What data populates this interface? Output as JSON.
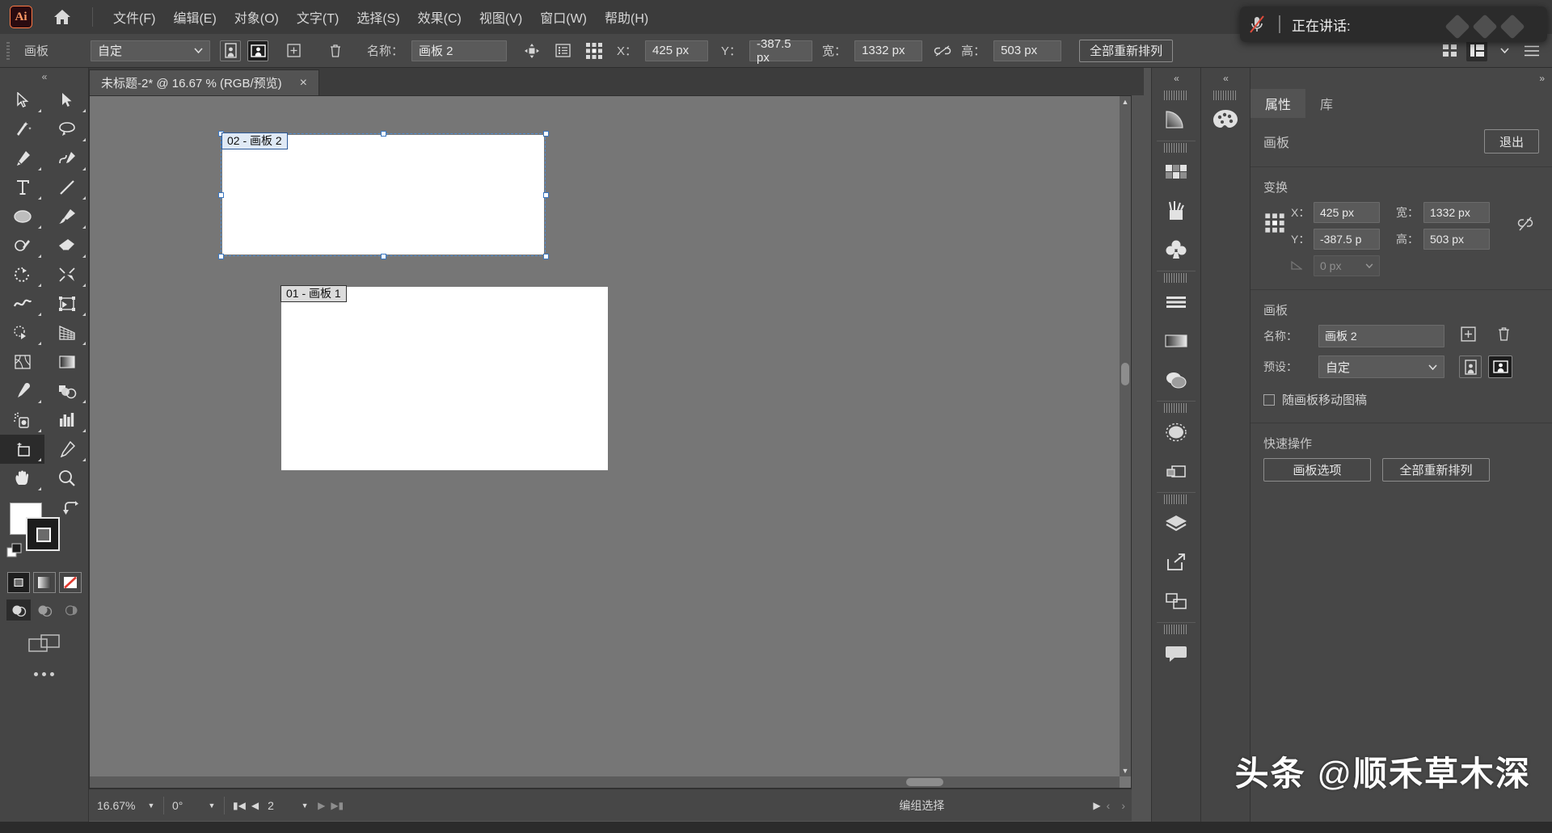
{
  "app": {
    "logo_text": "Ai",
    "home_icon": "home-icon"
  },
  "menubar": {
    "items": [
      {
        "label": "文件(F)"
      },
      {
        "label": "编辑(E)"
      },
      {
        "label": "对象(O)"
      },
      {
        "label": "文字(T)"
      },
      {
        "label": "选择(S)"
      },
      {
        "label": "效果(C)"
      },
      {
        "label": "视图(V)"
      },
      {
        "label": "窗口(W)"
      },
      {
        "label": "帮助(H)"
      }
    ]
  },
  "controlbar": {
    "tool_label": "画板",
    "preset_value": "自定",
    "orientation_portrait_icon": "portrait-icon",
    "orientation_landscape_icon": "landscape-icon",
    "new_artboard_icon": "new-artboard-icon",
    "delete_artboard_icon": "trash-icon",
    "name_label": "名称：",
    "name_value": "画板 2",
    "move_copy_icon": "move-artboard-icon",
    "options_icon": "artboard-options-icon",
    "reference_point_icon": "reference-point-icon",
    "x_label": "X：",
    "x_value": "425 px",
    "y_label": "Y：",
    "y_value": "-387.5 px",
    "w_label": "宽：",
    "w_value": "1332 px",
    "link_icon": "unlink-icon",
    "h_label": "高：",
    "h_value": "503 px",
    "rearrange_label": "全部重新排列",
    "right_icons": [
      "grid-view-icon",
      "workspace-icon",
      "chevron-down-icon",
      "menu-icon"
    ]
  },
  "toolbar": {
    "collapse_icon": "collapse-left-icon",
    "tools": [
      {
        "name": "selection-tool",
        "glyph": "select"
      },
      {
        "name": "direct-selection-tool",
        "glyph": "direct"
      },
      {
        "name": "magic-wand-tool",
        "glyph": "wand"
      },
      {
        "name": "lasso-tool",
        "glyph": "lasso"
      },
      {
        "name": "pen-tool",
        "glyph": "pen"
      },
      {
        "name": "curvature-tool",
        "glyph": "curvature"
      },
      {
        "name": "type-tool",
        "glyph": "type"
      },
      {
        "name": "line-segment-tool",
        "glyph": "line"
      },
      {
        "name": "ellipse-tool",
        "glyph": "ellipse"
      },
      {
        "name": "paintbrush-tool",
        "glyph": "brush"
      },
      {
        "name": "shaper-tool",
        "glyph": "shaper"
      },
      {
        "name": "eraser-tool",
        "glyph": "eraser"
      },
      {
        "name": "rotate-tool",
        "glyph": "rotate"
      },
      {
        "name": "scale-tool",
        "glyph": "scale"
      },
      {
        "name": "width-tool",
        "glyph": "width"
      },
      {
        "name": "free-transform-tool",
        "glyph": "freetransform"
      },
      {
        "name": "shape-builder-tool",
        "glyph": "shapebuilder"
      },
      {
        "name": "perspective-grid-tool",
        "glyph": "perspective"
      },
      {
        "name": "mesh-tool",
        "glyph": "mesh"
      },
      {
        "name": "gradient-tool",
        "glyph": "gradient"
      },
      {
        "name": "eyedropper-tool",
        "glyph": "eyedropper"
      },
      {
        "name": "blend-tool",
        "glyph": "blend"
      },
      {
        "name": "symbol-sprayer-tool",
        "glyph": "sprayer"
      },
      {
        "name": "column-graph-tool",
        "glyph": "graph"
      },
      {
        "name": "artboard-tool",
        "glyph": "artboard",
        "selected": true
      },
      {
        "name": "slice-tool",
        "glyph": "slice"
      },
      {
        "name": "hand-tool",
        "glyph": "hand"
      },
      {
        "name": "zoom-tool",
        "glyph": "zoom"
      }
    ],
    "fill_color": "#ffffff",
    "stroke_color": "#1c1c1c",
    "swap_icon": "swap-fill-stroke-icon",
    "default_icon": "default-fill-stroke-icon",
    "paint_modes": [
      "color-mode-icon",
      "gradient-mode-icon",
      "none-mode-icon"
    ],
    "draw_modes": [
      "draw-normal-icon",
      "draw-behind-icon",
      "draw-inside-icon"
    ],
    "screen_mode_icon": "screen-mode-icon",
    "more_icon": "more-tools-icon"
  },
  "document": {
    "tab_title": "未标题-2* @ 16.67 % (RGB/预览)",
    "close_icon": "close-icon"
  },
  "canvas": {
    "artboards": [
      {
        "id": "02",
        "label": "02 - 画板 2",
        "selected": true
      },
      {
        "id": "01",
        "label": "01 - 画板 1",
        "selected": false
      }
    ]
  },
  "statusbar": {
    "zoom_value": "16.67%",
    "rotation_value": "0°",
    "artboard_nav": {
      "first_icon": "first-artboard-icon",
      "prev_icon": "prev-artboard-icon",
      "value": "2",
      "next_icon": "next-artboard-icon",
      "last_icon": "last-artboard-icon"
    },
    "status_text": "编组选择",
    "play_icon": "play-icon",
    "prev_icon": "chevron-left-icon",
    "next_icon": "chevron-right-icon"
  },
  "dock": {
    "column1": [
      {
        "name": "gradient-panel-icon"
      },
      {
        "name": "swatches-panel-icon"
      },
      {
        "name": "brushes-panel-icon"
      },
      {
        "name": "symbols-panel-icon"
      },
      {
        "name": "align-panel-icon"
      },
      {
        "name": "stroke-panel-icon"
      },
      {
        "name": "transparency-panel-icon"
      },
      {
        "name": "appearance-panel-icon"
      },
      {
        "name": "pathfinder-panel-icon"
      },
      {
        "name": "layers-panel-icon"
      },
      {
        "name": "asset-export-panel-icon"
      },
      {
        "name": "artboards-panel-icon"
      },
      {
        "name": "comments-panel-icon"
      }
    ],
    "column2": [
      {
        "name": "color-panel-icon"
      }
    ],
    "collapse_icon": "collapse-right-icon"
  },
  "properties": {
    "collapse_icon": "expand-panel-icon",
    "tabs": [
      {
        "label": "属性",
        "active": true
      },
      {
        "label": "库",
        "active": false
      }
    ],
    "artboard_section": {
      "title": "画板",
      "exit_label": "退出"
    },
    "transform": {
      "title": "变换",
      "reference_point_icon": "reference-point-icon",
      "x_label": "X：",
      "x_value": "425 px",
      "y_label": "Y：",
      "y_value": "-387.5 p",
      "w_label": "宽：",
      "w_value": "1332 px",
      "h_label": "高：",
      "h_value": "503 px",
      "link_icon": "unlink-icon",
      "angle_label": "angle-icon",
      "angle_value": "0 px"
    },
    "artboard_props": {
      "title": "画板",
      "name_label": "名称：",
      "name_value": "画板 2",
      "add_icon": "new-artboard-icon",
      "delete_icon": "trash-icon",
      "preset_label": "预设：",
      "preset_value": "自定",
      "portrait_icon": "portrait-icon",
      "landscape_icon": "landscape-icon",
      "move_artwork_label": "随画板移动图稿",
      "move_artwork_checked": false
    },
    "quick_actions": {
      "title": "快速操作",
      "buttons": [
        {
          "label": "画板选项"
        },
        {
          "label": "全部重新排列"
        }
      ]
    }
  },
  "toast": {
    "mic_icon": "mic-muted-icon",
    "text": "正在讲话:"
  },
  "watermark": {
    "prefix": "头条",
    "at": "@",
    "handle": "顺禾草木深"
  },
  "colors": {
    "panel_bg": "#474747",
    "menu_bg": "#3b3b3b",
    "canvas_bg": "#767676",
    "accent_selection": "#4f8fd6",
    "artboard_white": "#ffffff"
  }
}
